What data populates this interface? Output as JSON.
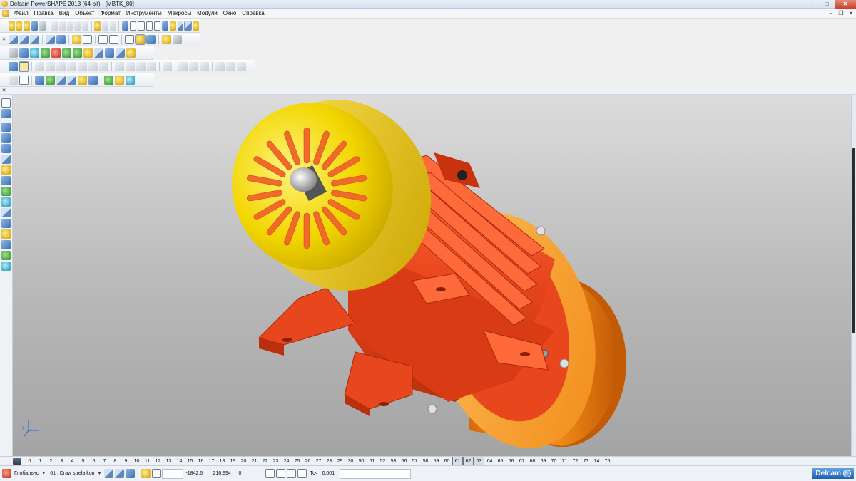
{
  "window": {
    "title": "Delcam PowerSHAPE 2013 (64-bit) - [MBTK_80]",
    "minimize_label": "–",
    "maximize_label": "□",
    "close_label": "✕"
  },
  "menu": {
    "items": [
      "Файл",
      "Правка",
      "Вид",
      "Объект",
      "Формат",
      "Инструменты",
      "Макросы",
      "Модули",
      "Окно",
      "Справка"
    ],
    "mdi_minimize": "–",
    "mdi_restore": "❐",
    "mdi_close": "✕"
  },
  "layers": {
    "numbers": [
      "0",
      "1",
      "2",
      "3",
      "4",
      "5",
      "6",
      "7",
      "8",
      "9",
      "10",
      "11",
      "12",
      "13",
      "14",
      "15",
      "16",
      "17",
      "18",
      "19",
      "20",
      "21",
      "22",
      "23",
      "24",
      "25",
      "26",
      "27",
      "28",
      "29",
      "30",
      "50",
      "51",
      "52",
      "53",
      "56",
      "57",
      "58",
      "59",
      "60",
      "61",
      "62",
      "63",
      "64",
      "65",
      "66",
      "67",
      "68",
      "69",
      "70",
      "71",
      "72",
      "73",
      "74",
      "75"
    ],
    "highlighted": [
      "61",
      "62",
      "63"
    ]
  },
  "status": {
    "workplane": "Глобальнс",
    "level": "61 : Draw strela kon",
    "x_coord": "-1842,6",
    "y_coord": "216,994",
    "z_coord": "0",
    "tolerance_label": "Точ",
    "tolerance_value": "0,001",
    "brand": "Delcam"
  },
  "colors": {
    "motor_body": "#e8461c",
    "fan_cover": "#f2d600",
    "fan_vents": "#f06a2a",
    "flange": "#f7a32e",
    "gearbox": "#e67e12",
    "viewport_top": "#dcdcdc",
    "viewport_bottom": "#a4a4a4"
  }
}
